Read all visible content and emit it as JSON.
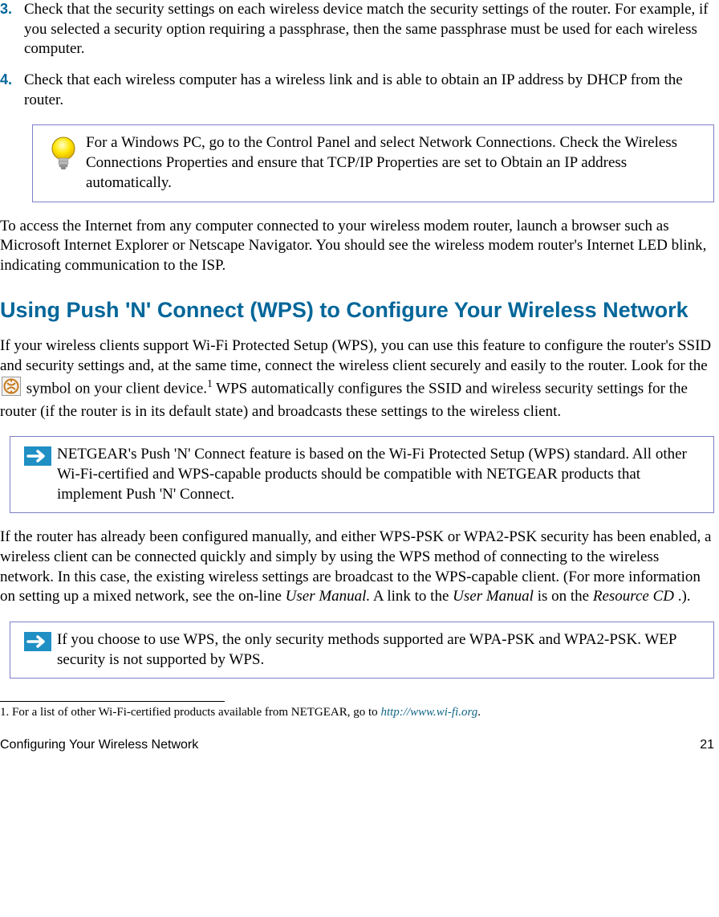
{
  "steps": [
    {
      "num": "3.",
      "text": "Check that the security settings on each wireless device match the security settings of the router. For example, if you selected a security option requiring a passphrase, then the same passphrase must be used for each wireless computer."
    },
    {
      "num": "4.",
      "text": "Check that each wireless computer has a wireless link and is able to obtain an IP address by DHCP from the router."
    }
  ],
  "tip1": "For a Windows PC, go to the Control Panel and select Network Connections. Check the Wireless Connections Properties and ensure that TCP/IP Properties are set to Obtain an IP address automatically.",
  "para1": "To access the Internet from any computer connected to your wireless modem router, launch a browser such as Microsoft Internet Explorer or Netscape Navigator. You should see the wireless modem router's Internet LED blink, indicating communication to the ISP.",
  "heading1": "Using Push 'N' Connect (WPS) to Configure Your Wireless Network",
  "wps_para": {
    "a": "If your wireless clients support Wi-Fi Protected Setup (WPS), you can use this feature to configure the router's SSID and security settings and, at the same time, connect the wireless client securely and easily to the router. Look for the ",
    "b": " symbol on your client device.",
    "sup": "1",
    "c": " WPS automatically configures the SSID and wireless security settings for the router (if the router is in its default state) and broadcasts these settings to the wireless client."
  },
  "note1": "NETGEAR's Push 'N' Connect feature is based on the Wi-Fi Protected Setup (WPS) standard. All other Wi-Fi-certified and WPS-capable products should be compatible with NETGEAR products that implement Push 'N' Connect.",
  "para2": {
    "a": "If the router has already been configured manually, and either WPS-PSK or WPA2-PSK security has been enabled, a wireless client can be connected quickly and simply by using the WPS method of connecting to the wireless network. In this case, the existing wireless settings are broadcast to the WPS-capable client. (For more information on setting up a mixed network, see the on-line ",
    "um1": "User Manual.",
    "b": " A link to the ",
    "um2": "User Manual",
    "c": " is on the ",
    "rcd": "Resource CD",
    "d": ".)."
  },
  "note2": "If you choose to use WPS, the only security methods supported are WPA-PSK and WPA2-PSK. WEP security is not supported by WPS.",
  "footnote": {
    "text": "1. For a list of other Wi-Fi-certified products available from NETGEAR, go to ",
    "link": "http://www.wi-fi.org",
    "dot": "."
  },
  "footer": {
    "left": "Configuring Your Wireless Network",
    "right": "21"
  }
}
